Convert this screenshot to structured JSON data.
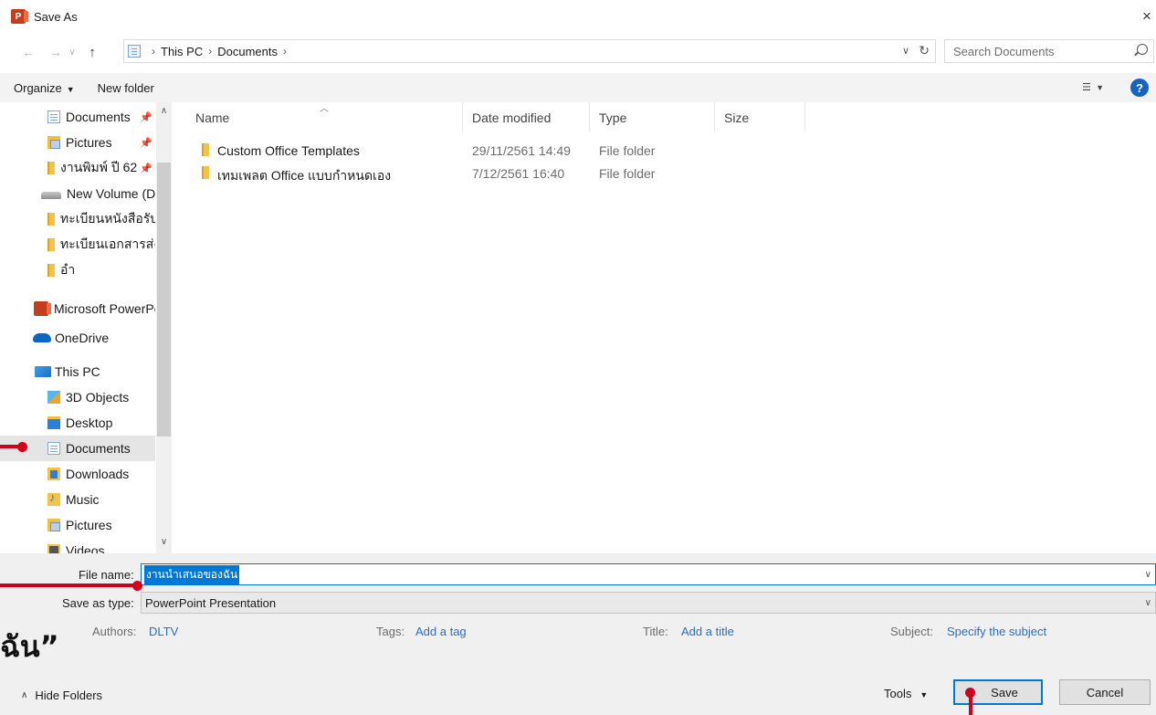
{
  "window": {
    "title": "Save As",
    "close_glyph": "×",
    "app_icon": "P"
  },
  "address": {
    "crumbs": [
      "This PC",
      "Documents"
    ],
    "search_placeholder": "Search Documents"
  },
  "commands": {
    "organize": "Organize",
    "new_folder": "New folder"
  },
  "nav": {
    "items": [
      {
        "label": "Documents",
        "icon": "documents-icon",
        "pinned": true
      },
      {
        "label": "Pictures",
        "icon": "pictures-icon",
        "pinned": true
      },
      {
        "label": "งานพิมพ์ ปี 62",
        "icon": "folder-icon",
        "pinned": true
      },
      {
        "label": "New Volume (D:)",
        "icon": "drive-icon",
        "pinned": false
      },
      {
        "label": "ทะเบียนหนังสือรับ",
        "icon": "folder-icon",
        "pinned": false
      },
      {
        "label": "ทะเบียนเอกสารส่ง",
        "icon": "folder-icon",
        "pinned": false
      },
      {
        "label": "อำ",
        "icon": "folder-icon",
        "pinned": false
      },
      {
        "label": "Microsoft PowerPoint",
        "icon": "powerpoint-icon",
        "pinned": false
      },
      {
        "label": "OneDrive",
        "icon": "onedrive-icon",
        "pinned": false
      },
      {
        "label": "This PC",
        "icon": "this-pc-icon",
        "pinned": false
      },
      {
        "label": "3D Objects",
        "icon": "3d-objects-icon",
        "pinned": false
      },
      {
        "label": "Desktop",
        "icon": "desktop-icon",
        "pinned": false
      },
      {
        "label": "Documents",
        "icon": "documents-icon",
        "pinned": false,
        "selected": true
      },
      {
        "label": "Downloads",
        "icon": "downloads-icon",
        "pinned": false
      },
      {
        "label": "Music",
        "icon": "music-icon",
        "pinned": false
      },
      {
        "label": "Pictures",
        "icon": "pictures-icon",
        "pinned": false
      },
      {
        "label": "Videos",
        "icon": "videos-icon",
        "pinned": false
      }
    ]
  },
  "list": {
    "columns": [
      "Name",
      "Date modified",
      "Type",
      "Size"
    ],
    "rows": [
      {
        "name": "Custom Office Templates",
        "date": "29/11/2561 14:49",
        "type": "File folder"
      },
      {
        "name": "เทมเพลต Office แบบกำหนดเอง",
        "date": "7/12/2561 16:40",
        "type": "File folder"
      }
    ]
  },
  "form": {
    "file_name_label": "File name:",
    "file_name_value": "งานนำเสนอของฉัน",
    "save_type_label": "Save as type:",
    "save_type_value": "PowerPoint Presentation",
    "authors_label": "Authors:",
    "authors_value": "DLTV",
    "tags_label": "Tags:",
    "tags_value": "Add a tag",
    "title_label": "Title:",
    "title_value": "Add a title",
    "subject_label": "Subject:",
    "subject_value": "Specify the subject"
  },
  "footer": {
    "hide_folders": "Hide Folders",
    "tools": "Tools",
    "save": "Save",
    "cancel": "Cancel"
  },
  "annotation": {
    "text": "ฉัน”",
    "color": "#d0021b"
  },
  "colors": {
    "accent": "#0078d7",
    "link": "#2a6ec2"
  }
}
